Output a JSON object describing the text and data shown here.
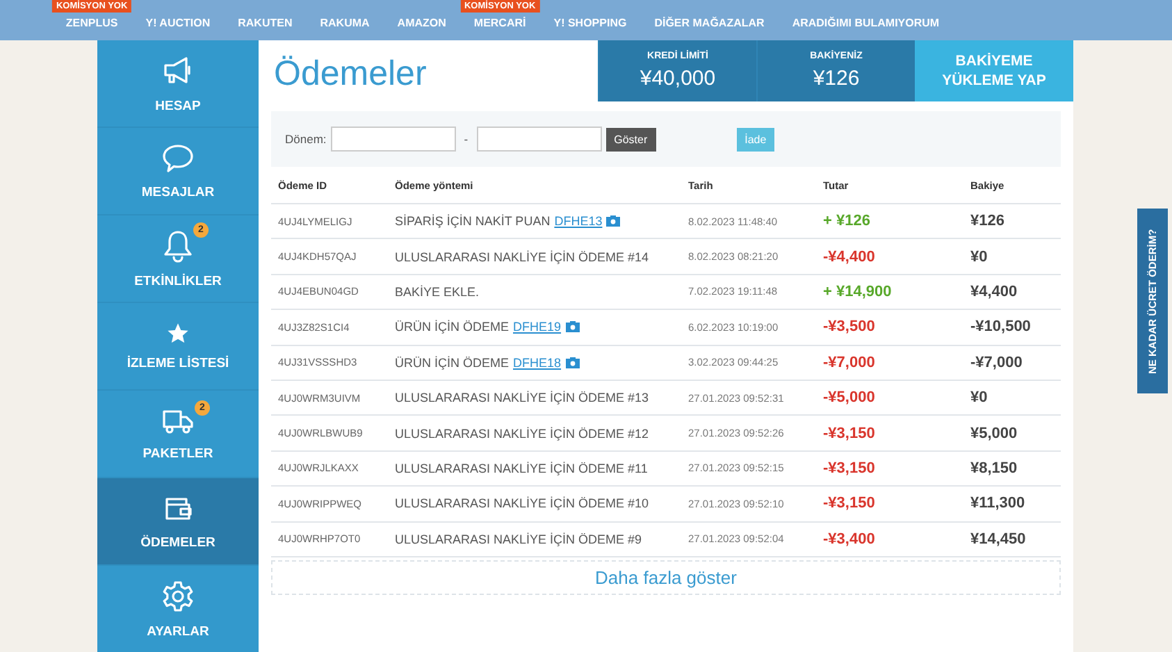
{
  "top_nav": [
    {
      "label": "ZENPLUS",
      "badge": "KOMİSYON YOK"
    },
    {
      "label": "Y! AUCTION"
    },
    {
      "label": "RAKUTEN"
    },
    {
      "label": "RAKUMA"
    },
    {
      "label": "AMAZON"
    },
    {
      "label": "MERCARİ",
      "badge": "KOMİSYON YOK"
    },
    {
      "label": "Y! SHOPPING"
    },
    {
      "label": "DİĞER MAĞAZALAR"
    },
    {
      "label": "ARADIĞIMI BULAMIYORUM"
    }
  ],
  "sidebar": {
    "items": [
      {
        "label": "HESAP",
        "selected": false
      },
      {
        "label": "MESAJLAR",
        "selected": false
      },
      {
        "label": "ETKİNLİKLER",
        "badge": "2",
        "selected": false
      },
      {
        "label": "İZLEME LİSTESİ",
        "selected": false
      },
      {
        "label": "PAKETLER",
        "badge": "2",
        "selected": false
      },
      {
        "label": "ÖDEMELER",
        "selected": true
      },
      {
        "label": "AYARLAR",
        "selected": false
      }
    ]
  },
  "page_title": "Ödemeler",
  "stats": [
    {
      "label": "KREDİ LİMİTİ",
      "value": "¥40,000"
    },
    {
      "label": "BAKİYENİZ",
      "value": "¥126"
    }
  ],
  "top_up_button": "BAKİYEME YÜKLEME YAP",
  "filter": {
    "label": "Dönem:",
    "separator": "-",
    "show_button": "Göster",
    "refund_button": "İade"
  },
  "table": {
    "columns": [
      "Ödeme ID",
      "Ödeme yöntemi",
      "Tarih",
      "Tutar",
      "Bakiye"
    ],
    "rows": [
      {
        "id": "4UJ4LYMELIGJ",
        "method": "SİPARİŞ İÇİN NAKİT PUAN",
        "link": "DFHE13",
        "date": "8.02.2023 11:48:40",
        "amount": "+ ¥126",
        "kind": "credit",
        "balance": "¥126"
      },
      {
        "id": "4UJ4KDH57QAJ",
        "method": "ULUSLARARASI NAKLİYE İÇİN ÖDEME #14",
        "date": "8.02.2023 08:21:20",
        "amount": "-¥4,400",
        "kind": "debit",
        "balance": "¥0"
      },
      {
        "id": "4UJ4EBUN04GD",
        "method": "BAKİYE EKLE.",
        "date": "7.02.2023 19:11:48",
        "amount": "+ ¥14,900",
        "kind": "credit",
        "balance": "¥4,400"
      },
      {
        "id": "4UJ3Z82S1CI4",
        "method": "ÜRÜN İÇİN ÖDEME",
        "link": "DFHE19",
        "date": "6.02.2023 10:19:00",
        "amount": "-¥3,500",
        "kind": "debit",
        "balance": "-¥10,500"
      },
      {
        "id": "4UJ31VSSSHD3",
        "method": "ÜRÜN İÇİN ÖDEME",
        "link": "DFHE18",
        "date": "3.02.2023 09:44:25",
        "amount": "-¥7,000",
        "kind": "debit",
        "balance": "-¥7,000"
      },
      {
        "id": "4UJ0WRM3UIVM",
        "method": "ULUSLARARASI NAKLİYE İÇİN ÖDEME #13",
        "date": "27.01.2023 09:52:31",
        "amount": "-¥5,000",
        "kind": "debit",
        "balance": "¥0"
      },
      {
        "id": "4UJ0WRLBWUB9",
        "method": "ULUSLARARASI NAKLİYE İÇİN ÖDEME #12",
        "date": "27.01.2023 09:52:26",
        "amount": "-¥3,150",
        "kind": "debit",
        "balance": "¥5,000"
      },
      {
        "id": "4UJ0WRJLKAXX",
        "method": "ULUSLARARASI NAKLİYE İÇİN ÖDEME #11",
        "date": "27.01.2023 09:52:15",
        "amount": "-¥3,150",
        "kind": "debit",
        "balance": "¥8,150"
      },
      {
        "id": "4UJ0WRIPPWEQ",
        "method": "ULUSLARARASI NAKLİYE İÇİN ÖDEME #10",
        "date": "27.01.2023 09:52:10",
        "amount": "-¥3,150",
        "kind": "debit",
        "balance": "¥11,300"
      },
      {
        "id": "4UJ0WRHP7OT0",
        "method": "ULUSLARARASI NAKLİYE İÇİN ÖDEME #9",
        "date": "27.01.2023 09:52:04",
        "amount": "-¥3,400",
        "kind": "debit",
        "balance": "¥14,450"
      }
    ]
  },
  "more_button": "Daha fazla göster",
  "side_tab": "NE KADAR ÜCRET ÖDERİM?"
}
